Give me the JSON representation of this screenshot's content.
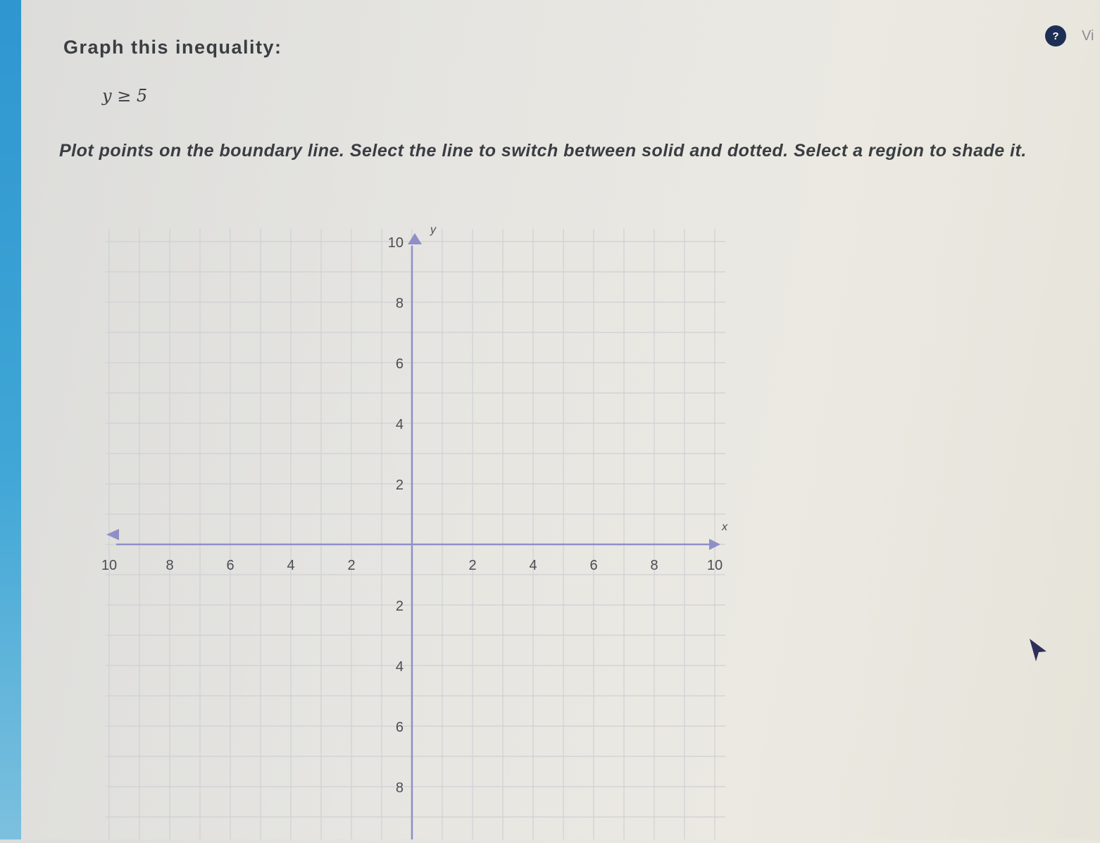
{
  "question": {
    "title": "Graph this inequality:",
    "inequality": "y ≥ 5",
    "instructions": "Plot points on the boundary line. Select the line to switch between solid and dotted. Select a region to shade it."
  },
  "header": {
    "help_icon_glyph": "?",
    "view_label": "Vi"
  },
  "graph": {
    "x_axis_label": "x",
    "y_axis_label": "y",
    "x_tick_labels": [
      "10",
      "8",
      "6",
      "4",
      "2",
      "2",
      "4",
      "6",
      "8",
      "10"
    ],
    "y_tick_labels": [
      "10",
      "8",
      "6",
      "4",
      "2",
      "2",
      "4",
      "6",
      "8"
    ],
    "x_ticks": [
      -10,
      -8,
      -6,
      -4,
      -2,
      2,
      4,
      6,
      8,
      10
    ],
    "y_ticks": [
      10,
      8,
      6,
      4,
      2,
      -2,
      -4,
      -6,
      -8
    ],
    "x_range": [
      -10,
      10
    ],
    "y_range": [
      -10,
      10
    ],
    "grid": true,
    "colors": {
      "axis": "#8f8fc8",
      "grid": "#cfd0d4",
      "tick_text": "#4a4d52"
    }
  }
}
